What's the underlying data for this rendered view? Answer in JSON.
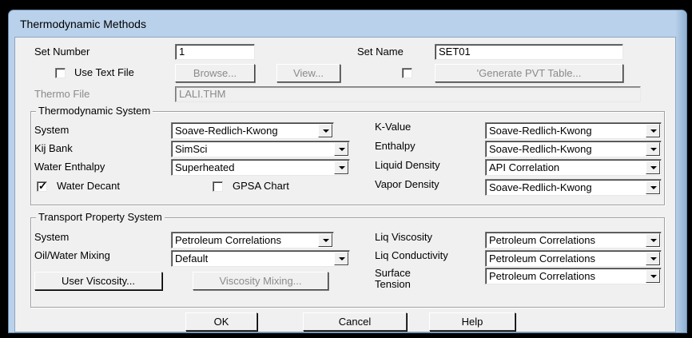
{
  "window": {
    "title": "Thermodynamic Methods"
  },
  "header": {
    "set_number_label": "Set Number",
    "set_number_value": "1",
    "set_name_label": "Set Name",
    "set_name_value": "SET01",
    "use_text_file_label": "Use Text File",
    "use_text_file_checked": false,
    "browse_label": "Browse...",
    "view_label": "View...",
    "generate_pvt_checked": false,
    "generate_pvt_label": "'Generate PVT Table...",
    "thermo_file_label": "Thermo File",
    "thermo_file_value": "LALI.THM"
  },
  "thermo_system": {
    "title": "Thermodynamic System",
    "system_label": "System",
    "system_value": "Soave-Redlich-Kwong",
    "kij_bank_label": "Kij Bank",
    "kij_bank_value": "SimSci",
    "water_enthalpy_label": "Water Enthalpy",
    "water_enthalpy_value": "Superheated",
    "water_decant_label": "Water Decant",
    "water_decant_checked": true,
    "gpsa_chart_label": "GPSA Chart",
    "gpsa_chart_checked": false,
    "kvalue_label": "K-Value",
    "kvalue_value": "Soave-Redlich-Kwong",
    "enthalpy_label": "Enthalpy",
    "enthalpy_value": "Soave-Redlich-Kwong",
    "liquid_density_label": "Liquid Density",
    "liquid_density_value": "API Correlation",
    "vapor_density_label": "Vapor Density",
    "vapor_density_value": "Soave-Redlich-Kwong"
  },
  "transport_system": {
    "title": "Transport Property System",
    "system_label": "System",
    "system_value": "Petroleum Correlations",
    "oil_water_label": "Oil/Water Mixing",
    "oil_water_value": "Default",
    "user_viscosity_label": "User Viscosity...",
    "viscosity_mixing_label": "Viscosity Mixing...",
    "liq_viscosity_label": "Liq Viscosity",
    "liq_viscosity_value": "Petroleum Correlations",
    "liq_conductivity_label": "Liq Conductivity",
    "liq_conductivity_value": "Petroleum Correlations",
    "surface_tension_label_1": "Surface",
    "surface_tension_label_2": "Tension",
    "surface_tension_value": "Petroleum Correlations"
  },
  "footer": {
    "ok_label": "OK",
    "cancel_label": "Cancel",
    "help_label": "Help"
  },
  "colors": {
    "frame": "#b9d1ea",
    "client_bg": "#f0f0f0",
    "desktop": "#000000"
  }
}
